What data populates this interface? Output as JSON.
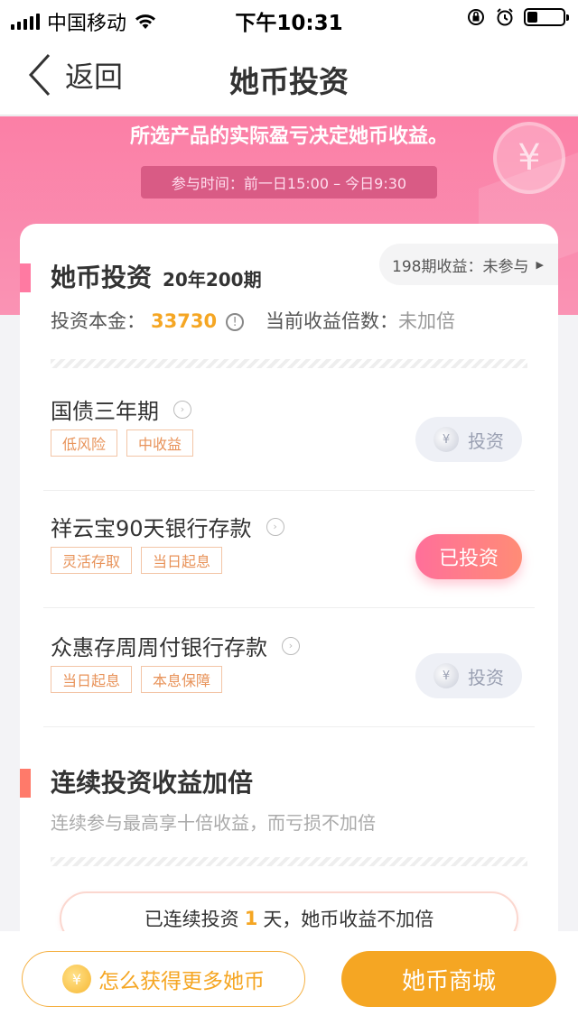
{
  "status_bar": {
    "carrier": "中国移动",
    "time": "下午10:31",
    "battery_level": 0.25
  },
  "nav": {
    "back_label": "返回",
    "title": "她币投资"
  },
  "banner": {
    "note": "所选产品的实际盈亏决定她币收益。",
    "time_text": "参与时间：前一日15:00 – 今日9:30"
  },
  "invest": {
    "title": "她币投资",
    "period": "20年200期",
    "prev_period_pill": "198期收益：未参与",
    "principal_label": "投资本金：",
    "principal_value": "33730",
    "multiplier_label": "当前收益倍数：",
    "multiplier_value": "未加倍"
  },
  "products": [
    {
      "name": "国债三年期",
      "tags": [
        "低风险",
        "中收益"
      ],
      "button": "投资",
      "invested": false
    },
    {
      "name": "祥云宝90天银行存款",
      "tags": [
        "灵活存取",
        "当日起息"
      ],
      "button": "已投资",
      "invested": true
    },
    {
      "name": "众惠存周周付银行存款",
      "tags": [
        "当日起息",
        "本息保障"
      ],
      "button": "投资",
      "invested": false
    }
  ],
  "streak": {
    "title": "连续投资收益加倍",
    "subtitle": "连续参与最高享十倍收益，而亏损不加倍",
    "prefix": "已连续投资",
    "days": "1",
    "suffix": "天，她币收益不加倍"
  },
  "bottom": {
    "earn_label": "怎么获得更多她币",
    "mall_label": "她币商城"
  },
  "colors": {
    "accent_pink": "#fb7fa6",
    "accent_orange": "#f5a623",
    "tag_orange": "#e8935a"
  }
}
